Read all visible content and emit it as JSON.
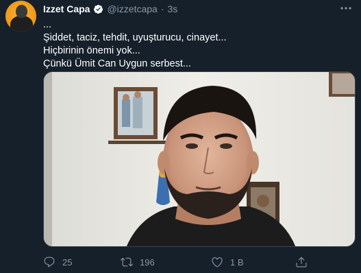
{
  "tweet": {
    "author": {
      "name": "Izzet Capa",
      "handle": "@izzetcapa",
      "verified": true,
      "avatar_icon": "avatar-portrait"
    },
    "separator": "·",
    "time": "3s",
    "more_icon": "more-horizontal-icon",
    "text_lines": [
      "...",
      "Şiddet, taciz, tehdit, uyuşturucu, cinayet...",
      "Hiçbirinin önemi yok...",
      "Çünkü Ümit Can Uygun serbest..."
    ],
    "media": {
      "type": "photo"
    },
    "actions": {
      "reply": {
        "icon": "reply-icon",
        "count": "25"
      },
      "retweet": {
        "icon": "retweet-icon",
        "count": "196"
      },
      "like": {
        "icon": "heart-icon",
        "count": "1 B"
      },
      "share": {
        "icon": "share-icon"
      }
    }
  },
  "colors": {
    "background": "#15202b",
    "secondary_text": "#8899a6",
    "verified_blue": "#1da1f2",
    "border": "#38444d"
  }
}
